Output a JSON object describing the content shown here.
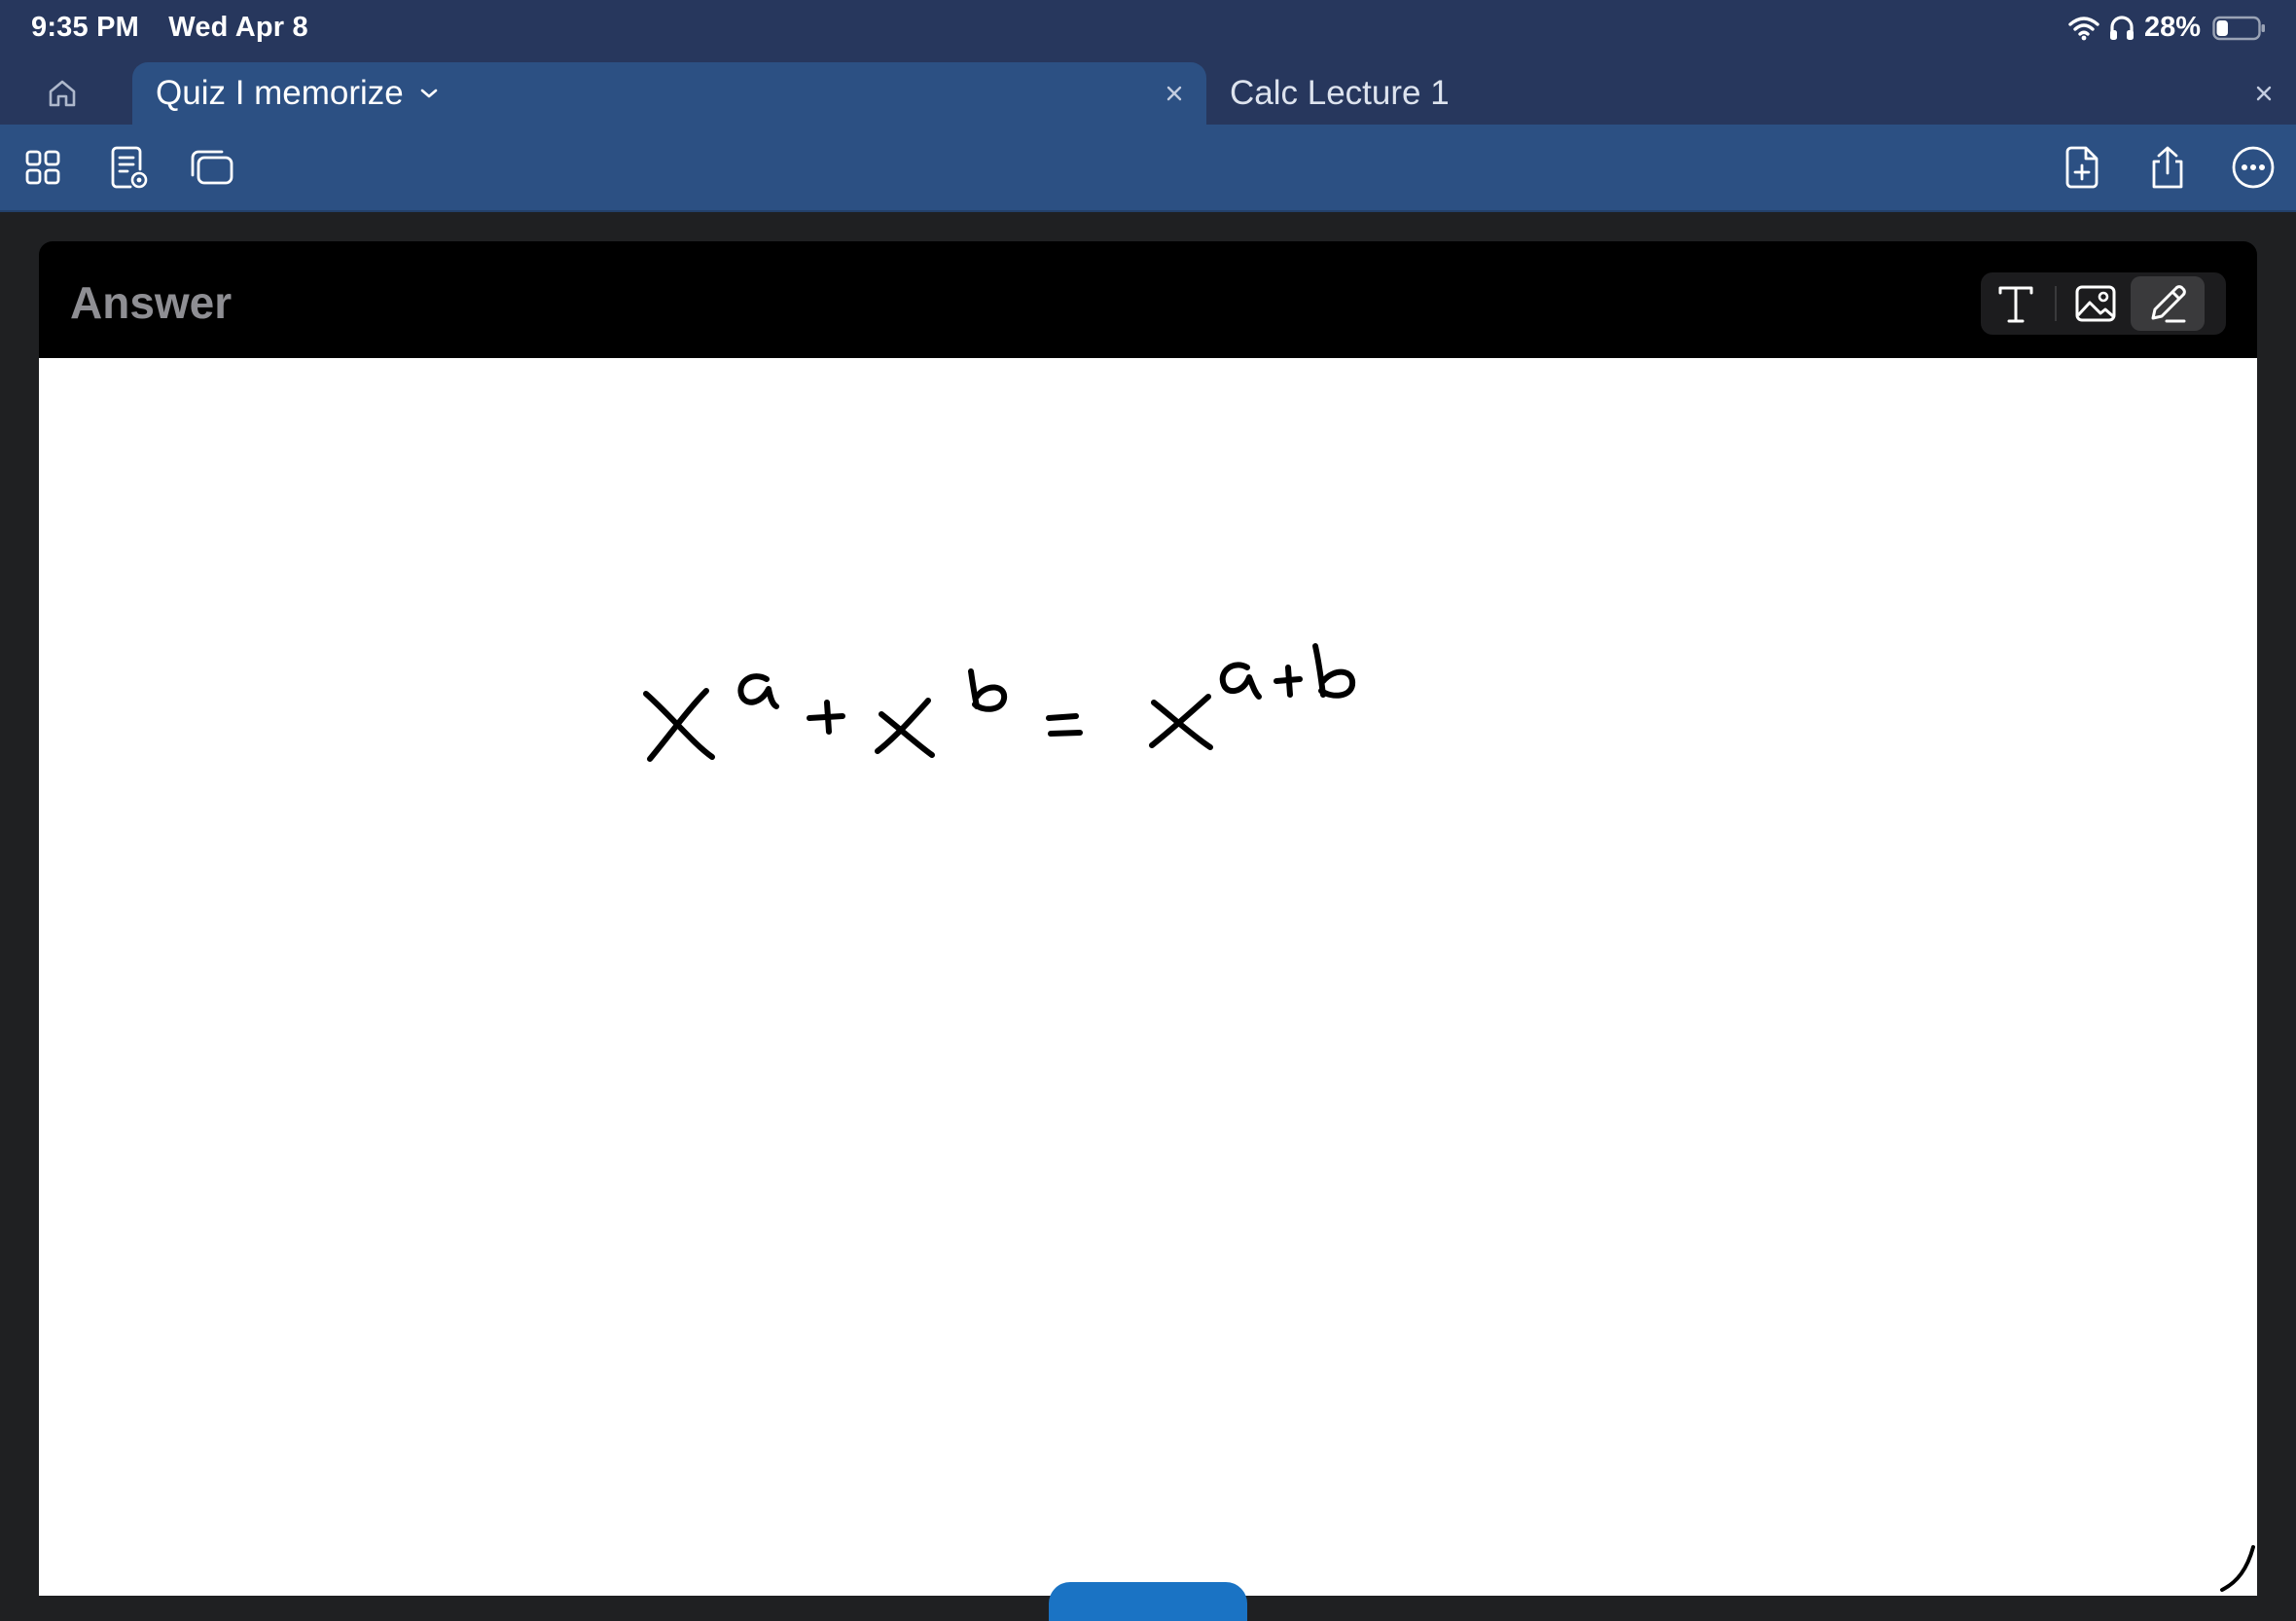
{
  "status_bar": {
    "time": "9:35 PM",
    "date": "Wed Apr 8",
    "battery_percent": "28%",
    "battery_level": 0.28
  },
  "tabs": [
    {
      "title": "Quiz I memorize",
      "active": true
    },
    {
      "title": "Calc Lecture 1",
      "active": false
    }
  ],
  "toolbar": {
    "left_icons": [
      "grid-icon",
      "document-preview-icon",
      "cards-icon"
    ],
    "right_icons": [
      "add-page-icon",
      "share-icon",
      "more-icon"
    ]
  },
  "card": {
    "title": "Answer",
    "insert_tools": [
      "text-tool-icon",
      "image-tool-icon",
      "pen-tool-icon"
    ],
    "selected_tool": "pen"
  },
  "colors": {
    "status_bar_bg": "#27375d",
    "active_tab_bg": "#2c5083",
    "toolbar_bg": "#2c5083",
    "card_header_bg": "#000000",
    "canvas_bg": "#ffffff",
    "accent_blue": "#1a73c4"
  }
}
